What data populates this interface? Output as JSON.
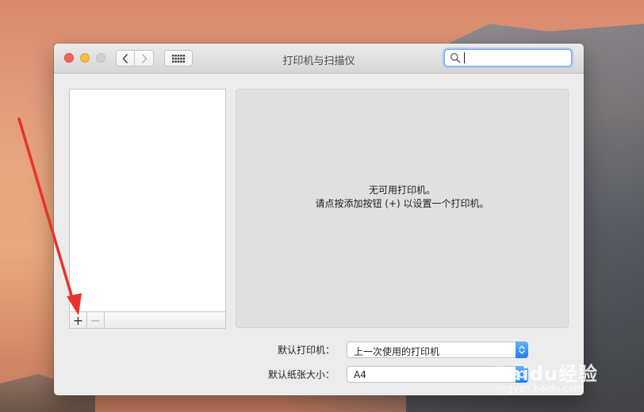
{
  "window": {
    "title": "打印机与扫描仪"
  },
  "search": {
    "value": "",
    "placeholder": ""
  },
  "printer_list": {
    "items": [],
    "add_label": "+",
    "remove_label": "−"
  },
  "detail": {
    "message_line1": "无可用打印机。",
    "message_line2": "请点按添加按钮 (+) 以设置一个打印机。"
  },
  "settings": {
    "default_printer_label": "默认打印机：",
    "default_printer_value": "上一次使用的打印机",
    "default_paper_label": "默认纸张大小：",
    "default_paper_value": "A4"
  },
  "icons": {
    "back": "chevron-left-icon",
    "forward": "chevron-right-icon",
    "grid": "grid-icon",
    "search": "magnifier-icon"
  },
  "colors": {
    "close": "#fc605c",
    "minimize": "#fdbc40",
    "maximize": "#d1d1d1",
    "accent": "#1a7ef3",
    "annotation_arrow": "#e8332a"
  },
  "watermark": {
    "text": "Baidu经验",
    "sub": "jingyan.baidu.com"
  }
}
